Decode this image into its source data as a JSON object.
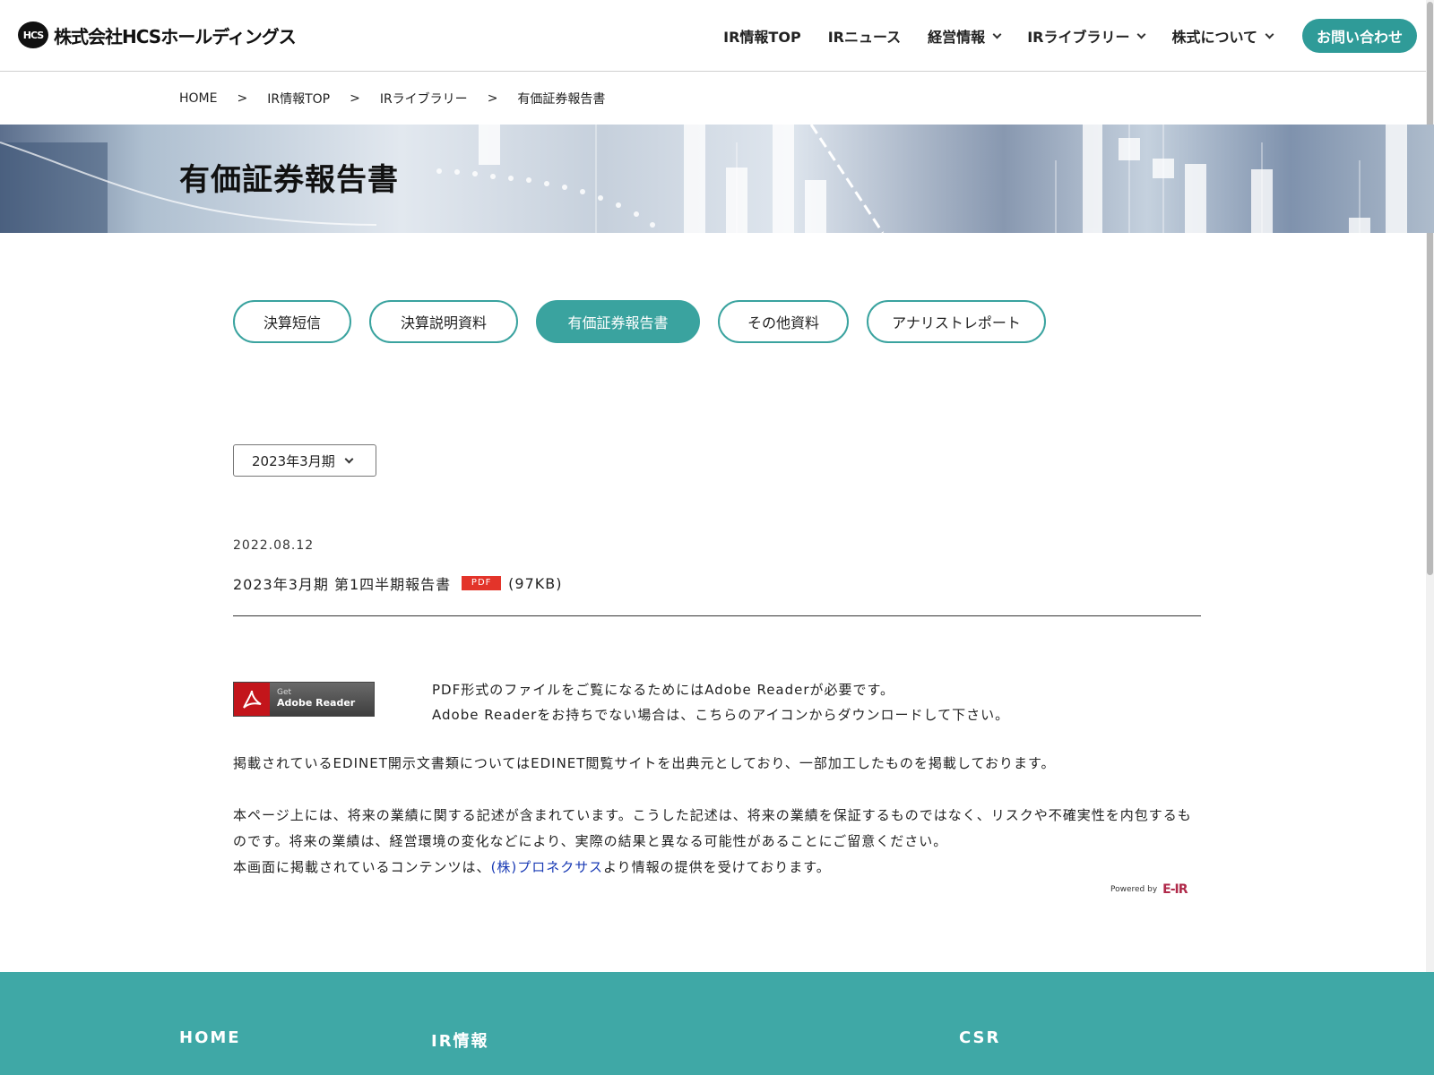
{
  "header": {
    "logo_mark": "HCS",
    "logo_text": "株式会社HCSホールディングス",
    "nav": [
      {
        "label": "IR情報TOP"
      },
      {
        "label": "IRニュース"
      },
      {
        "label": "経営情報"
      },
      {
        "label": "IRライブラリー"
      },
      {
        "label": "株式について"
      }
    ],
    "contact_label": "お問い合わせ"
  },
  "breadcrumb": {
    "items": [
      "HOME",
      "IR情報TOP",
      "IRライブラリー",
      "有価証券報告書"
    ],
    "separator": ">"
  },
  "hero": {
    "title": "有価証券報告書"
  },
  "tabs": [
    {
      "label": "決算短信",
      "active": false
    },
    {
      "label": "決算説明資料",
      "active": false
    },
    {
      "label": "有価証券報告書",
      "active": true
    },
    {
      "label": "その他資料",
      "active": false
    },
    {
      "label": "アナリストレポート",
      "active": false
    }
  ],
  "period_select": {
    "value": "2023年3月期"
  },
  "documents": [
    {
      "date": "2022.08.12",
      "title": "2023年3月期 第1四半期報告書",
      "badge": "PDF",
      "size": "(97KB)"
    }
  ],
  "adobe": {
    "badge_small": "Get",
    "badge_large": "Adobe Reader",
    "line1": "PDF形式のファイルをご覧になるためにはAdobe Readerが必要です。",
    "line2": "Adobe Readerをお持ちでない場合は、こちらのアイコンからダウンロードして下さい。"
  },
  "notices": {
    "edinet": "掲載されているEDINET開示文書類についてはEDINET閲覧サイトを出典元としており、一部加工したものを掲載しております。",
    "forward_looking": "本ページ上には、将来の業績に関する記述が含まれています。こうした記述は、将来の業績を保証するものではなく、リスクや不確実性を内包するものです。将来の業績は、経営環境の変化などにより、実際の結果と異なる可能性があることにご留意ください。",
    "provider_prefix": "本画面に掲載されているコンテンツは、",
    "provider_link": "(株)プロネクサス",
    "provider_suffix": "より情報の提供を受けております。"
  },
  "powered_by": {
    "label": "Powered by",
    "logo": "E-IR"
  },
  "footer": {
    "links": [
      "HOME",
      "IR情報",
      "CSR"
    ]
  },
  "colors": {
    "brand": "#2f9b98",
    "tab_border": "#3aa39f",
    "footer": "#3fa8a6",
    "pdf_badge": "#e3342a",
    "link": "#1a3bb5"
  }
}
